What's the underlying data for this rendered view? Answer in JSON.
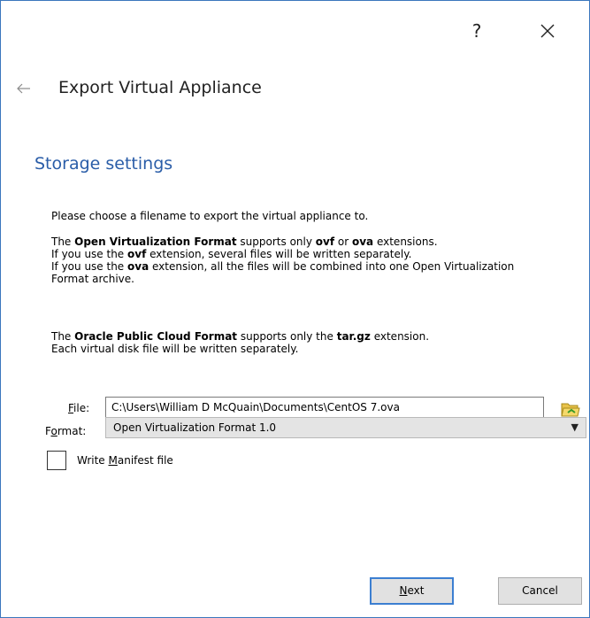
{
  "window": {
    "help_label": "?",
    "close_icon": "close-icon",
    "back_icon": "back-arrow-icon"
  },
  "heading": "Export Virtual Appliance",
  "subheading": "Storage settings",
  "intro": "Please choose a filename to export the virtual appliance to.",
  "ovf_text": {
    "p1_a": "The ",
    "p1_b": "Open Virtualization Format",
    "p1_c": " supports only ",
    "p1_d": "ovf",
    "p1_e": " or ",
    "p1_f": "ova",
    "p1_g": " extensions.",
    "p2_a": "If you use the ",
    "p2_b": "ovf",
    "p2_c": " extension, several files will be written separately.",
    "p3_a": "If you use the ",
    "p3_b": "ova",
    "p3_c": " extension, all the files will be combined into one Open Virtualization Format archive."
  },
  "opc_text": {
    "p1_a": "The ",
    "p1_b": "Oracle Public Cloud Format",
    "p1_c": " supports only the ",
    "p1_d": "tar.gz",
    "p1_e": " extension.",
    "p2": "Each virtual disk file will be written separately."
  },
  "file": {
    "label_acc": "F",
    "label_rest": "ile:",
    "value": "C:\\Users\\William D McQuain\\Documents\\CentOS 7.ova",
    "browse_icon": "folder-open-icon"
  },
  "format": {
    "label_pre": "F",
    "label_acc": "o",
    "label_rest": "rmat:",
    "selected": "Open Virtualization Format 1.0"
  },
  "manifest": {
    "label_pre": "Write ",
    "label_acc": "M",
    "label_rest": "anifest file",
    "checked": false
  },
  "buttons": {
    "next_acc": "N",
    "next_rest": "ext",
    "cancel": "Cancel"
  },
  "colors": {
    "accent": "#2a5da8",
    "border": "#3b77bd"
  }
}
